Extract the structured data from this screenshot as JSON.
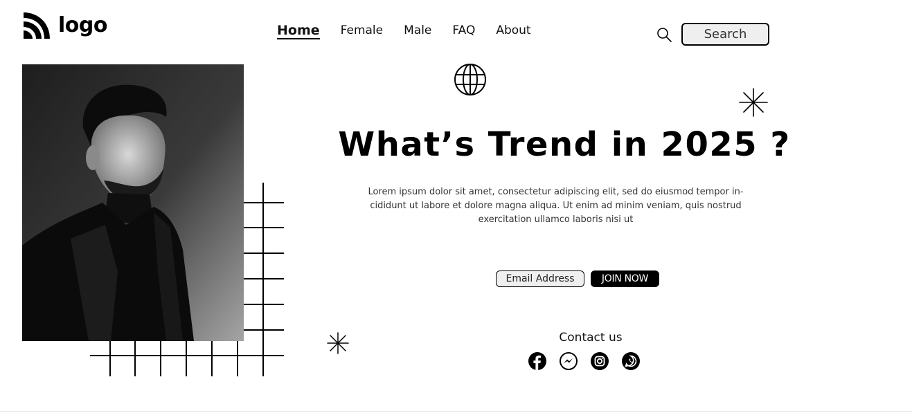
{
  "header": {
    "logo_text": "logo",
    "nav": [
      {
        "label": "Home",
        "active": true
      },
      {
        "label": "Female",
        "active": false
      },
      {
        "label": "Male",
        "active": false
      },
      {
        "label": "FAQ",
        "active": false
      },
      {
        "label": "About",
        "active": false
      }
    ],
    "search_label": "Search"
  },
  "hero": {
    "headline": "What’s Trend in 2025 ?",
    "body": "Lorem ipsum dolor sit amet, consectetur adipiscing elit, sed do eiusmod tempor in- cididunt ut labore et dolore magna aliqua. Ut enim ad minim veniam, quis nostrud exercitation ullamco laboris nisi ut",
    "email_placeholder": "Email Address",
    "join_label": "JOIN NOW"
  },
  "contact": {
    "title": "Contact us",
    "icons": [
      "facebook-icon",
      "messenger-icon",
      "instagram-icon",
      "whatsapp-icon"
    ]
  },
  "colors": {
    "primary": "#000000",
    "background": "#ffffff",
    "pill": "#efefef"
  }
}
